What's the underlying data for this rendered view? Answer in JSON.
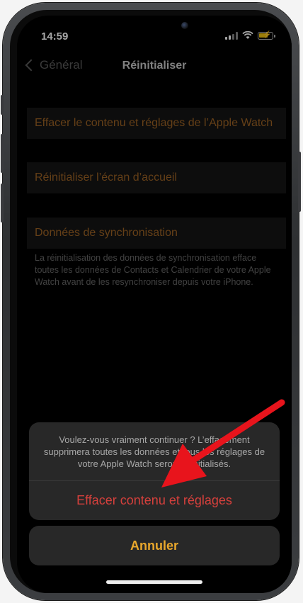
{
  "status_bar": {
    "time": "14:59"
  },
  "nav": {
    "back_label": "Général",
    "title": "Réinitialiser"
  },
  "settings": {
    "items": [
      {
        "label": "Effacer le contenu et réglages de l’Apple Watch"
      },
      {
        "label": "Réinitialiser l’écran d’accueil"
      },
      {
        "label": "Données de synchronisation"
      }
    ],
    "footnote": "La réinitialisation des données de synchronisation efface toutes les données de Contacts et Calendrier de votre Apple Watch avant de les resynchroniser depuis votre iPhone."
  },
  "action_sheet": {
    "message": "Voulez-vous vraiment continuer ? L’effacement supprimera toutes les données et tous les réglages de votre Apple Watch seront réinitialisés.",
    "destructive_label": "Effacer contenu et réglages",
    "cancel_label": "Annuler"
  },
  "colors": {
    "accent": "#e8a72c",
    "destructive": "#d6403c",
    "annotation_arrow": "#e8141c"
  },
  "icons": [
    "signal-icon",
    "wifi-icon",
    "battery-charging-icon",
    "chevron-left-icon"
  ]
}
